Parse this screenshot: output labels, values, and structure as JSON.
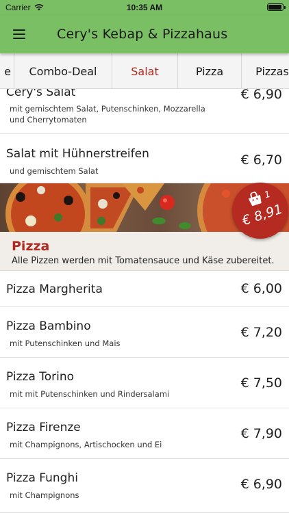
{
  "status": {
    "carrier": "Carrier",
    "time": "10:35 AM"
  },
  "appbar": {
    "title": "Cery's Kebap & Pizzahaus"
  },
  "tabs": [
    "e",
    "Combo-Deal",
    "Salat",
    "Pizza",
    "Pizzas"
  ],
  "active_tab": "Salat",
  "salat_items": [
    {
      "name": "Cery's Salat",
      "desc": "mit gemischtem Salat, Putenschinken, Mozzarella und Cherrytomaten",
      "price": "€ 6,90"
    },
    {
      "name": "Salat mit Hühnerstreifen",
      "desc": "und gemischtem Salat",
      "price": "€ 6,70"
    }
  ],
  "section": {
    "title": "Pizza",
    "description": "Alle Pizzen werden mit Tomatensauce und Käse zubereitet."
  },
  "pizza_items": [
    {
      "name": "Pizza Margherita",
      "desc": "",
      "price": "€ 6,00"
    },
    {
      "name": "Pizza Bambino",
      "desc": "mit Putenschinken und Mais",
      "price": "€ 7,20"
    },
    {
      "name": "Pizza Torino",
      "desc": "mit mit Putenschinken und Rindersalami",
      "price": "€ 7,50"
    },
    {
      "name": "Pizza Firenze",
      "desc": "mit Champignons, Artischocken und Ei",
      "price": "€ 7,90"
    },
    {
      "name": "Pizza Funghi",
      "desc": "mit Champignons",
      "price": "€ 6,90"
    }
  ],
  "cart": {
    "count": "1",
    "total": "€ 8,91"
  },
  "colors": {
    "accent_green": "#7bbf64",
    "brand_red": "#b02a22"
  },
  "icons": {
    "menu": "hamburger-menu-icon",
    "cart": "shopping-bag-icon",
    "wifi": "wifi-icon",
    "battery": "battery-icon"
  }
}
